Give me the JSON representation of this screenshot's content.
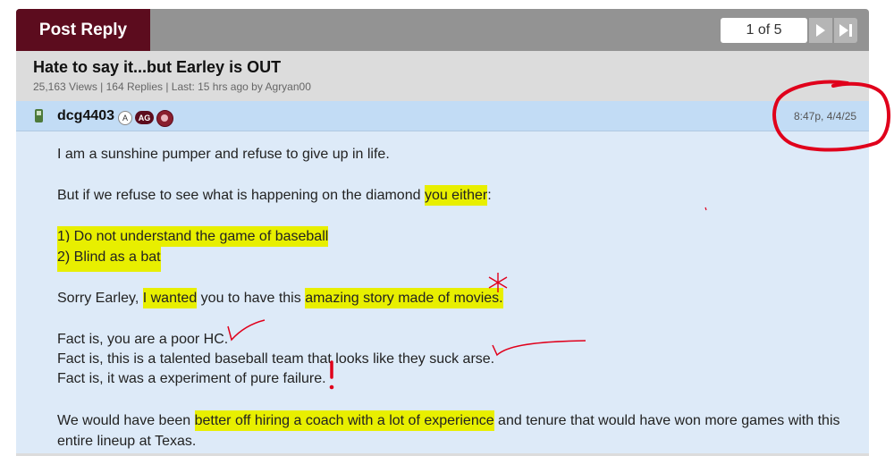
{
  "toolbar": {
    "post_reply_label": "Post Reply"
  },
  "pagination": {
    "text": "1 of 5",
    "next_icon": "play-icon",
    "last_icon": "skip-end-icon"
  },
  "thread": {
    "title": "Hate to say it...but Earley is OUT",
    "stats": "25,163 Views | 164 Replies | Last: 15 hrs ago by Agryan00"
  },
  "post": {
    "username": "dcg4403",
    "badges": {
      "a": "A",
      "ag": "AG"
    },
    "timestamp": "8:47p, 4/4/25",
    "lines": {
      "l1": "I am a sunshine pumper and refuse to give up in life.",
      "l2a": "But if we refuse to see what is happening on the diamond ",
      "l2b": "you either",
      "l2c": ":",
      "l3": "1) Do not understand the game of baseball",
      "l4": "2) Blind as a bat",
      "l5a": "Sorry Earley, ",
      "l5b": "I wanted",
      "l5c": " you to have this ",
      "l5d": "amazing story made of movies.",
      "l6": "Fact is, you are a poor HC.",
      "l7": "Fact is, this is a talented baseball team that looks like they suck arse.",
      "l8": "Fact is, it was a experiment of pure failure.",
      "l9a": "We would have been ",
      "l9b": "better off hiring a coach with a lot of experience",
      "l9c": " and tenure that would have won more games with this",
      "l10": "entire lineup at Texas."
    }
  },
  "colors": {
    "maroon": "#5c0c1e",
    "highlight": "#e8ef00",
    "post_bg": "#ddeaf8",
    "ink_red": "#e0001b"
  }
}
